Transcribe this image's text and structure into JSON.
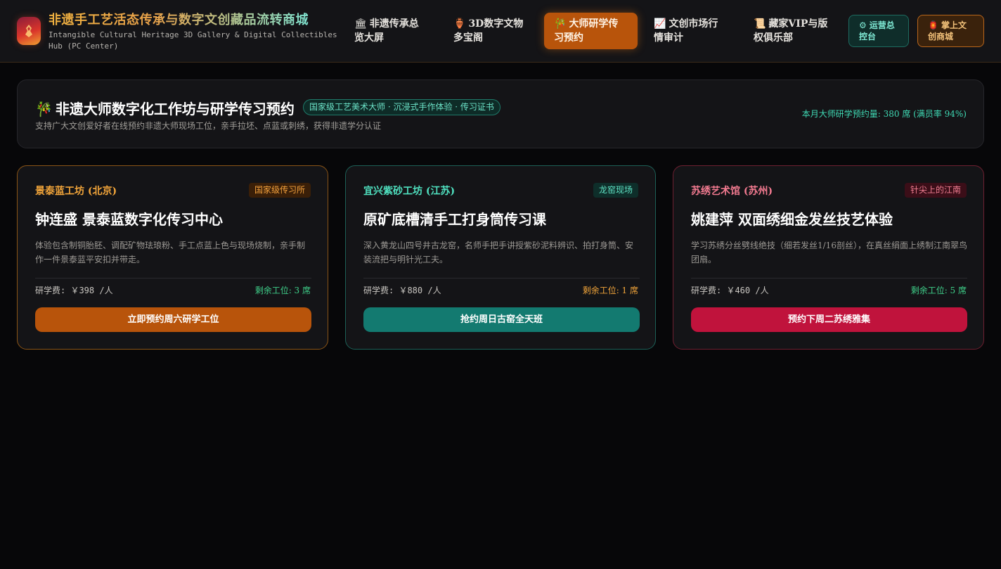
{
  "header": {
    "title": "非遗手工艺活态传承与数字文创藏品流转商城",
    "subtitle": "Intangible Cultural Heritage 3D Gallery & Digital Collectibles Hub (PC Center)",
    "nav": [
      {
        "icon": "🏛",
        "label": "非遗传承总览大屏"
      },
      {
        "icon": "🏺",
        "label": "3D数字文物多宝阁"
      },
      {
        "icon": "🎋",
        "label": "大师研学传习预约"
      },
      {
        "icon": "📈",
        "label": "文创市场行情审计"
      },
      {
        "icon": "📜",
        "label": "藏家VIP与版权俱乐部"
      }
    ],
    "ops_button": {
      "icon": "⚙",
      "label": "运营总控台"
    },
    "shop_button": {
      "icon": "🏮",
      "label": "掌上文创商城"
    }
  },
  "banner": {
    "icon": "🎋",
    "title": "非遗大师数字化工作坊与研学传习预约",
    "badge": "国家级工艺美术大师 · 沉浸式手作体验 · 传习证书",
    "description": "支持广大文创爱好者在线预约非遗大师现场工位，亲手拉坯、点蓝或刺绣，获得非遗学分认证",
    "stat": "本月大师研学预约量: 380 席 (满员率 94%)"
  },
  "cards": [
    {
      "studio": "景泰蓝工坊 (北京)",
      "tag": "国家级传习所",
      "title": "钟连盛 景泰蓝数字化传习中心",
      "description": "体验包含制铜胎胚、调配矿物珐琅粉、手工点蓝上色与现场烧制，亲手制作一件景泰蓝平安扣并带走。",
      "fee": "研学费: ￥398 /人",
      "seats": "剩余工位: 3 席",
      "button": "立即预约周六研学工位"
    },
    {
      "studio": "宜兴紫砂工坊 (江苏)",
      "tag": "龙窑现场",
      "title": "原矿底槽清手工打身筒传习课",
      "description": "深入黄龙山四号井古龙窑，名师手把手讲授紫砂泥料辨识、拍打身筒、安装流把与明针光工夫。",
      "fee": "研学费: ￥880 /人",
      "seats": "剩余工位: 1 席",
      "button": "抢约周日古窑全天班"
    },
    {
      "studio": "苏绣艺术馆 (苏州)",
      "tag": "针尖上的江南",
      "title": "姚建萍 双面绣细金发丝技艺体验",
      "description": "学习苏绣分丝劈线绝技（细若发丝1/16剖丝），在真丝绢面上绣制江南翠鸟团扇。",
      "fee": "研学费: ￥460 /人",
      "seats": "剩余工位: 5 席",
      "button": "预约下周二苏绣雅集"
    }
  ],
  "colors": {
    "accent_orange": "#b8540b",
    "accent_teal": "#137a70",
    "accent_crimson": "#c0133c",
    "background": "#070709",
    "panel": "#141417"
  }
}
